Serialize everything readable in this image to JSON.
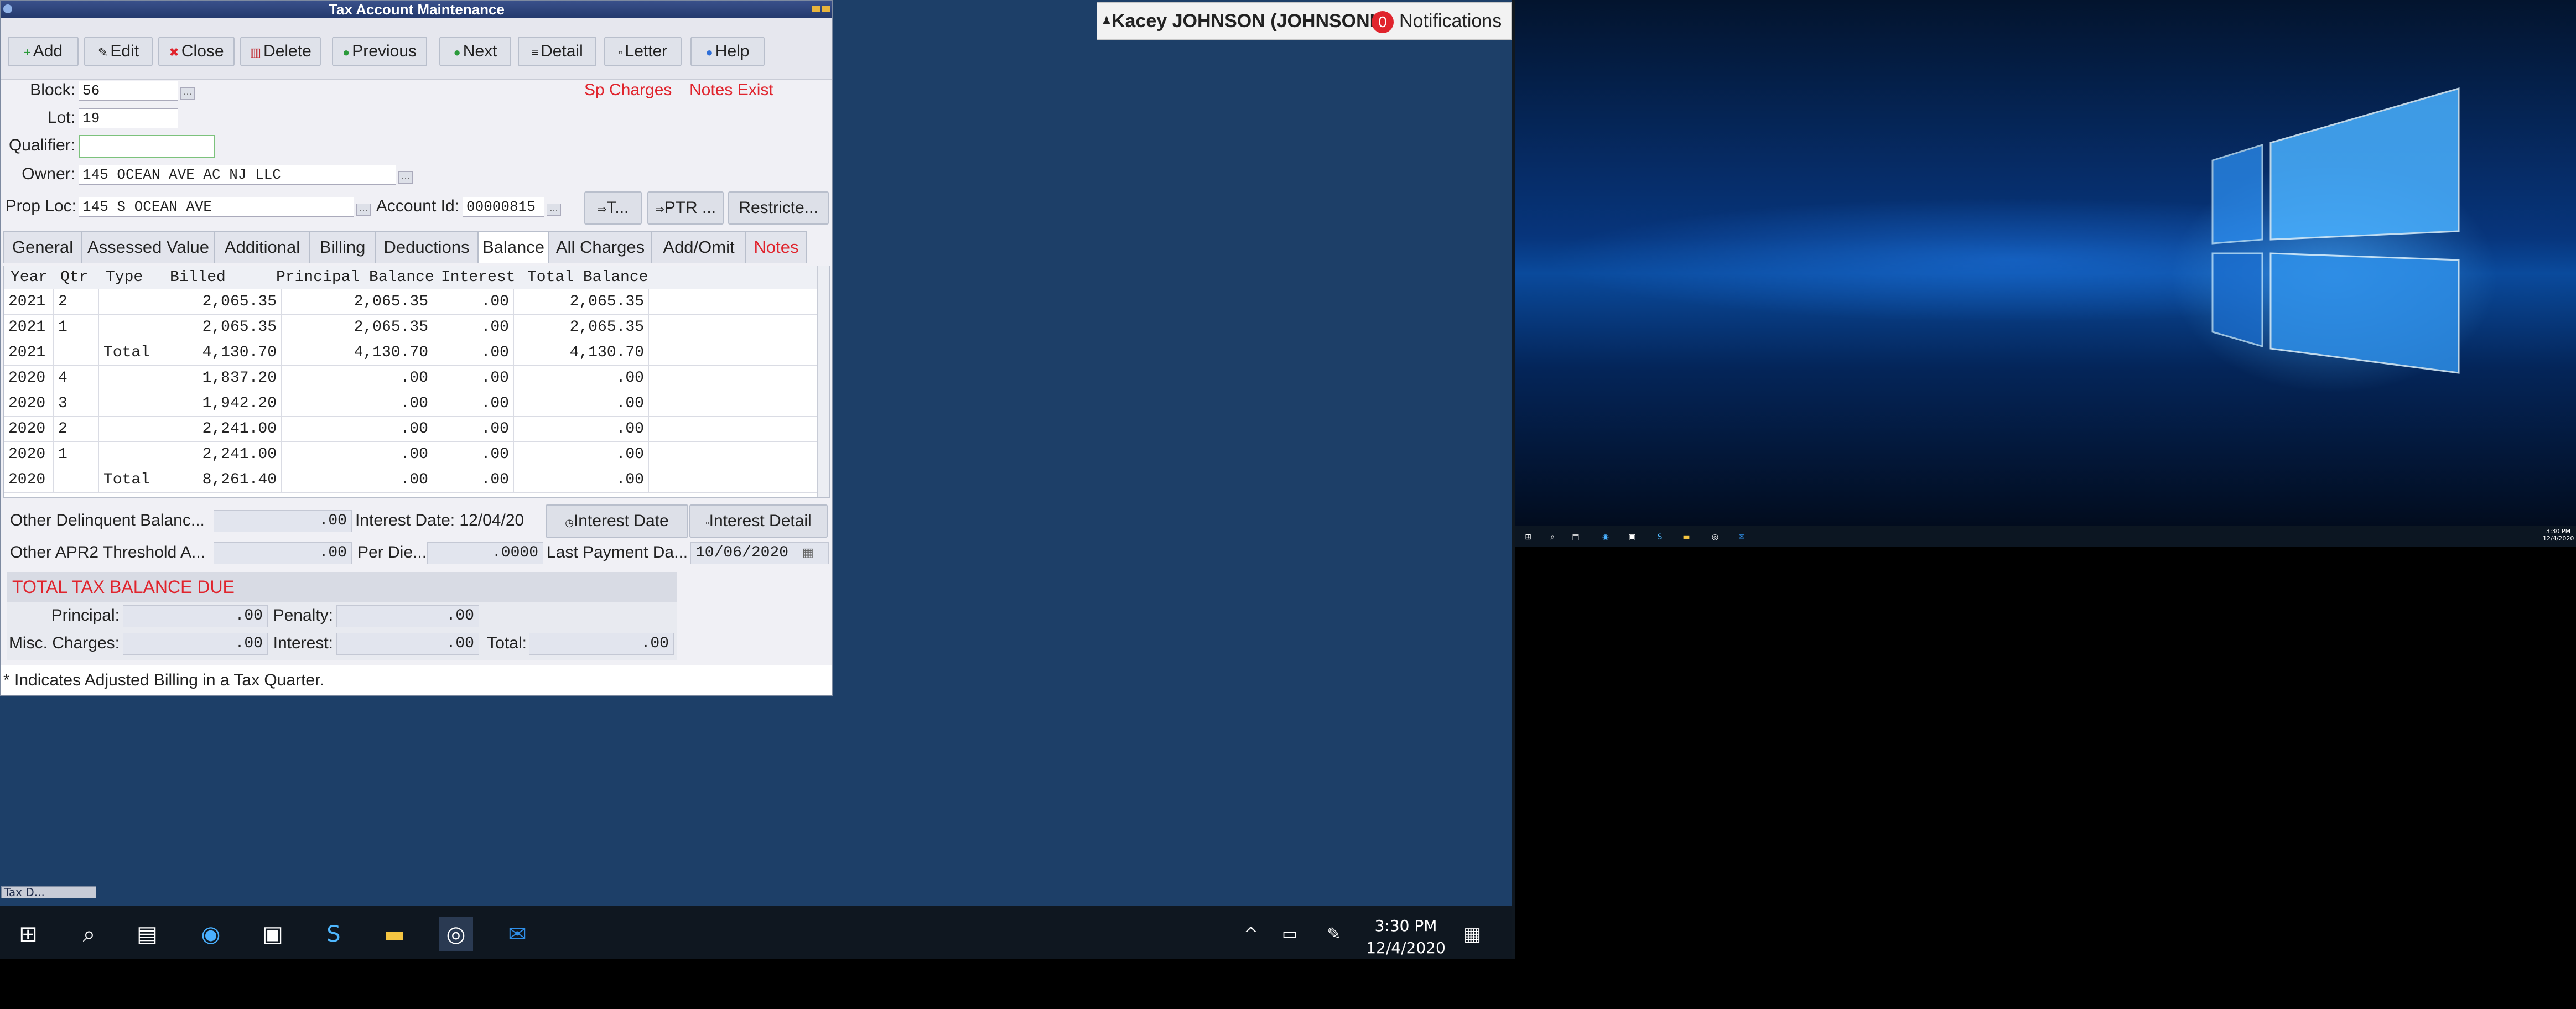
{
  "window": {
    "title": "Tax Account Maintenance"
  },
  "toolbar": {
    "add": "Add",
    "edit": "Edit",
    "close": "Close",
    "delete": "Delete",
    "previous": "Previous",
    "next": "Next",
    "detail": "Detail",
    "letter": "Letter",
    "help": "Help"
  },
  "form": {
    "block_label": "Block:",
    "block_value": "56",
    "lot_label": "Lot:",
    "lot_value": "19",
    "qualifier_label": "Qualifier:",
    "qualifier_value": "",
    "owner_label": "Owner:",
    "owner_value": "145 OCEAN AVE AC NJ LLC",
    "proploc_label": "Prop Loc:",
    "proploc_value": "145 S OCEAN AVE",
    "account_label": "Account Id:",
    "account_value": "00000815",
    "sp_charges": "Sp Charges",
    "notes_exist": "Notes Exist",
    "btn_t": "T...",
    "btn_ptr": "PTR ...",
    "btn_restrict": "Restricte..."
  },
  "tabs": [
    "General",
    "Assessed Value",
    "Additional",
    "Billing",
    "Deductions",
    "Balance",
    "All Charges",
    "Add/Omit",
    "Notes"
  ],
  "active_tab": "Balance",
  "grid": {
    "headers": [
      "Year",
      "Qtr",
      "Type",
      "Billed",
      "Principal Balance",
      "Interest",
      "Total Balance"
    ],
    "rows": [
      [
        "2021",
        "2",
        "",
        "2,065.35",
        "2,065.35",
        ".00",
        "2,065.35"
      ],
      [
        "2021",
        "1",
        "",
        "2,065.35",
        "2,065.35",
        ".00",
        "2,065.35"
      ],
      [
        "2021",
        "",
        "Total",
        "4,130.70",
        "4,130.70",
        ".00",
        "4,130.70"
      ],
      [
        "2020",
        "4",
        "",
        "1,837.20",
        ".00",
        ".00",
        ".00"
      ],
      [
        "2020",
        "3",
        "",
        "1,942.20",
        ".00",
        ".00",
        ".00"
      ],
      [
        "2020",
        "2",
        "",
        "2,241.00",
        ".00",
        ".00",
        ".00"
      ],
      [
        "2020",
        "1",
        "",
        "2,241.00",
        ".00",
        ".00",
        ".00"
      ],
      [
        "2020",
        "",
        "Total",
        "8,261.40",
        ".00",
        ".00",
        ".00"
      ]
    ]
  },
  "summary": {
    "other_delinquent_label": "Other Delinquent Balanc...",
    "other_delinquent_value": ".00",
    "interest_date_text": "Interest Date: 12/04/20",
    "interest_date_btn": "Interest Date",
    "interest_detail_btn": "Interest Detail",
    "apr2_label": "Other APR2 Threshold A...",
    "apr2_value": ".00",
    "per_diem_label": "Per Die...",
    "per_diem_value": ".0000",
    "last_payment_label": "Last Payment Da...",
    "last_payment_value": "10/06/2020"
  },
  "totals": {
    "header": "TOTAL TAX BALANCE DUE",
    "principal_label": "Principal:",
    "principal_value": ".00",
    "penalty_label": "Penalty:",
    "penalty_value": ".00",
    "misc_label": "Misc. Charges:",
    "misc_value": ".00",
    "interest_label": "Interest:",
    "interest_value": ".00",
    "total_label": "Total:",
    "total_value": ".00"
  },
  "footer": "* Indicates Adjusted Billing in a Tax Quarter.",
  "user": {
    "name": "Kacey JOHNSON (JOHNSONK)",
    "notif_count": "0",
    "notif_label": "Notifications"
  },
  "taskbar": {
    "time": "3:30 PM",
    "date": "12/4/2020"
  },
  "taskbar2": {
    "time": "3:30 PM",
    "date": "12/4/2020"
  },
  "minimized": {
    "label": "Tax D..."
  }
}
